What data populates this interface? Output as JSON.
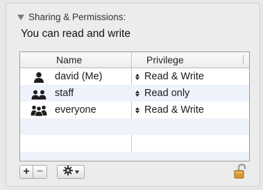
{
  "section": {
    "title": "Sharing & Permissions:"
  },
  "permission_summary": "You can read and write",
  "table": {
    "columns": {
      "name": "Name",
      "privilege": "Privilege"
    },
    "rows": [
      {
        "name": "david (Me)",
        "privilege": "Read & Write",
        "icon": "single-user-icon"
      },
      {
        "name": "staff",
        "privilege": "Read only",
        "icon": "group-icon"
      },
      {
        "name": "everyone",
        "privilege": "Read & Write",
        "icon": "everyone-icon"
      }
    ]
  },
  "toolbar": {
    "add_label": "+",
    "remove_label": "−"
  },
  "colors": {
    "row_stripe": "#eef3fb",
    "lock_gold": "#d79a2b"
  }
}
